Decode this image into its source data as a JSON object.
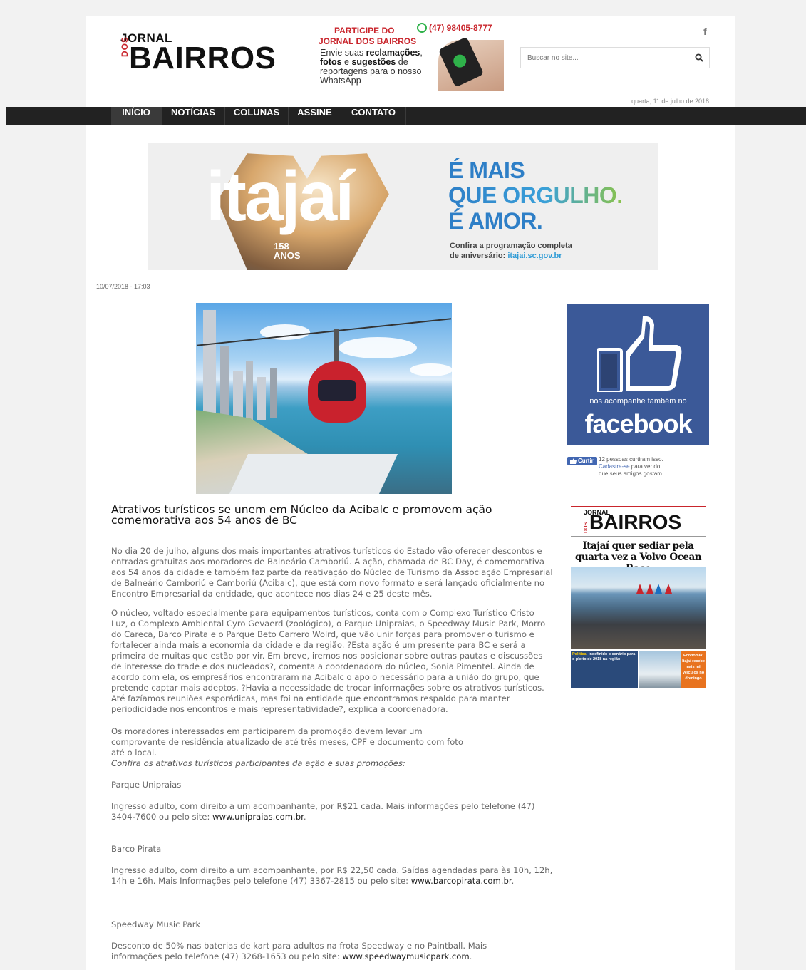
{
  "header": {
    "logo": {
      "jornal": "JORNAL",
      "dos": "DOS",
      "bairros": "BAIRROS"
    },
    "whatsapp_banner": {
      "line1": "PARTICIPE DO",
      "phone": "(47) 98405-8777",
      "line2": "JORNAL DOS BAIRROS",
      "text_a": "Envie suas ",
      "text_b": "reclamações",
      "text_c": ", ",
      "text_d": "fotos",
      "text_e": " e ",
      "text_f": "sugestões",
      "text_g": " de reportagens para o nosso WhatsApp"
    },
    "facebook_glyph": "f",
    "search_placeholder": "Buscar no site...",
    "date": "quarta, 11 de julho de 2018"
  },
  "nav": {
    "items": [
      {
        "label": "INÍCIO",
        "active": true
      },
      {
        "label": "NOTÍCIAS"
      },
      {
        "label": "COLUNAS"
      },
      {
        "label": "ASSINE"
      },
      {
        "label": "CONTATO"
      }
    ]
  },
  "promo": {
    "word": "itajaí",
    "years": "158",
    "years_label": "ANOS",
    "line1": "É MAIS",
    "line2": "QUE ORGULHO.",
    "line3": "É AMOR.",
    "sub1": "Confira a programação completa",
    "sub2": "de aniversário: ",
    "url": "itajai.sc.gov.br"
  },
  "article": {
    "date": "10/07/2018 - 17:03",
    "title": "Atrativos turísticos se unem em Núcleo da Acibalc e promovem ação comemorativa aos 54 anos de BC",
    "p1": "No dia 20 de julho, alguns dos mais importantes atrativos turísticos do Estado vão oferecer descontos e entradas gratuitas aos moradores de Balneário Camboriú. A ação, chamada de BC Day, é comemorativa aos 54 anos da cidade e também faz parte da reativação do Núcleo de Turismo da Associação Empresarial de Balneário Camboriú e Camboriú (Acibalc), que está com novo formato e será lançado oficialmente no Encontro Empresarial da entidade, que acontece nos dias 24 e 25 deste mês.",
    "p2": "O núcleo, voltado especialmente para equipamentos turísticos, conta com o Complexo Turístico Cristo Luz, o Complexo Ambiental Cyro Gevaerd (zoológico), o Parque Unipraias, o Speedway Music Park, Morro do Careca, Barco Pirata e o Parque Beto Carrero Wolrd, que vão unir forças para promover o turismo e fortalecer ainda mais a economia da cidade e da região. ?Esta ação é um presente para BC e será a primeira de muitas que estão por vir. Em breve, iremos nos posicionar sobre outras pautas e discussões de interesse do trade e dos nucleados?, comenta a coordenadora do núcleo, Sonia Pimentel. Ainda de acordo com ela, os empresários encontraram na Acibalc o apoio necessário para a união do grupo, que pretende captar mais adeptos. ?Havia a necessidade de trocar informações sobre os atrativos turísticos. Até fazíamos reuniões esporádicas, mas foi na entidade que encontramos respaldo para manter periodicidade nos encontros e mais representatividade?, explica a coordenadora.",
    "p3": "Os moradores interessados em participarem da promoção devem levar um comprovante de residência atualizado de até três meses, CPF e documento com foto até o local.",
    "p4": "Confira os atrativos turísticos participantes da ação e suas promoções:",
    "s1_title": "Parque Unipraias",
    "s1_text": "Ingresso adulto, com direito a um acompanhante, por R$21 cada. Mais informações pelo telefone (47) 3404-7600 ou pelo site: ",
    "s1_link": "www.unipraias.com.br",
    "s2_title": "Barco Pirata",
    "s2_text": "Ingresso adulto, com direito a um acompanhante, por R$ 22,50 cada. Saídas agendadas para às 10h, 12h, 14h e 16h. Mais Informações pelo telefone (47) 3367-2815 ou pelo site: ",
    "s2_link": "www.barcopirata.com.br",
    "s3_title": "Speedway Music Park",
    "s3_text": "Desconto de 50% nas baterias de kart para adultos na frota Speedway e no Paintball. Mais informações pelo telefone (47) 3268-1653 ou pelo site: ",
    "s3_link": "www.speedwaymusicpark.com",
    "period": "."
  },
  "sidebar": {
    "facebook": {
      "small": "nos acompanhe também no",
      "big": "facebook"
    },
    "like": {
      "button": "Curtir",
      "count_text": "12 pessoas curtiram isso.",
      "signup": "Cadastre-se",
      "signup_rest": " para ver do",
      "line3": "que seus amigos gostam."
    },
    "cover": {
      "jornal": "JORNAL",
      "dos": "DOS",
      "bairros": "BAIRROS",
      "headline": "Itajaí quer sediar pela quarta vez a Volvo Ocean Race",
      "left_label": "Política:",
      "left_caption": " Indefinido o cenário para o pleito de 2018 na região",
      "right_caption": "Economia: Itajaí recebe mais mil veículos no domingo"
    }
  }
}
